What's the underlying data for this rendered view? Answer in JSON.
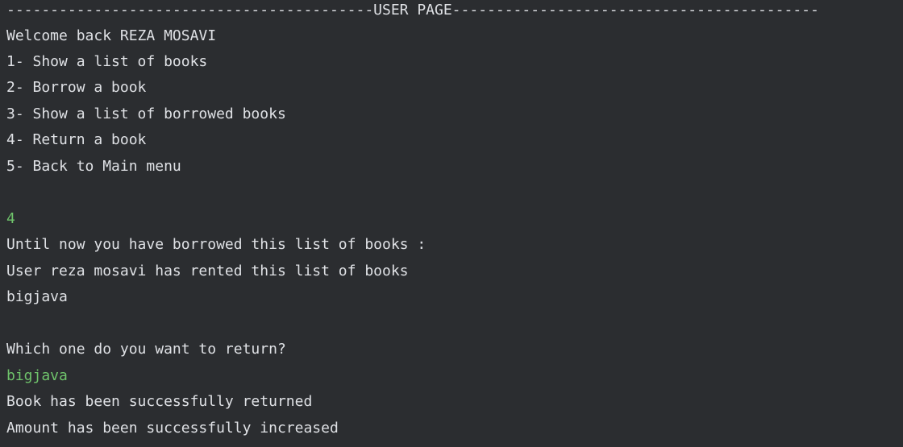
{
  "console": {
    "header": "------------------------------------------USER PAGE------------------------------------------",
    "welcome": "Welcome back REZA MOSAVI",
    "menu": [
      "1- Show a list of books",
      "2- Borrow a book",
      "3- Show a list of borrowed books",
      "4- Return a book",
      "5- Back to Main menu"
    ],
    "user_choice": "4",
    "borrowed_intro": "Until now you have borrowed this list of books :",
    "rented_info": "User reza mosavi has rented this list of books",
    "book_listed": "bigjava",
    "return_prompt": "Which one do you want to return?",
    "user_book_input": "bigjava",
    "return_success": "Book has been successfully returned",
    "amount_success": "Amount has been successfully increased",
    "colors": {
      "background": "#2b2d30",
      "text": "#dfe1e5",
      "user_input": "#6fc36b"
    }
  }
}
